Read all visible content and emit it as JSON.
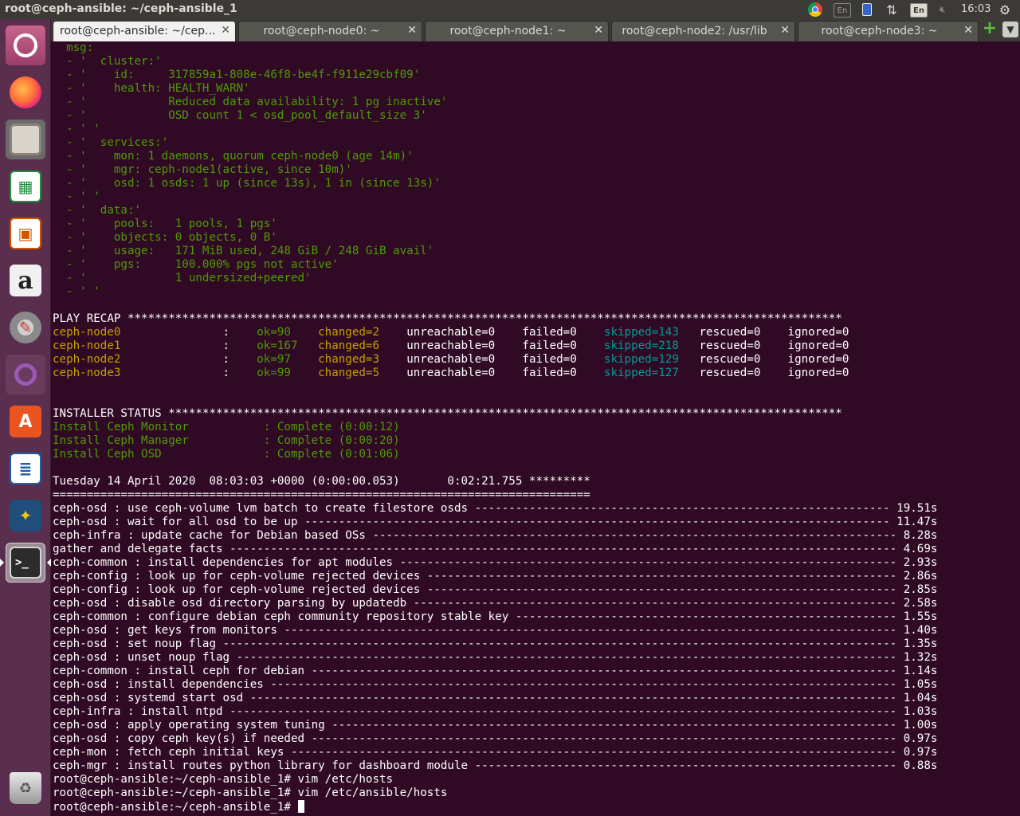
{
  "window": {
    "title": "root@ceph-ansible: ~/ceph-ansible_1"
  },
  "tray": {
    "keyboard_inactive": "En",
    "keyboard_active": "En",
    "clock": "16:03"
  },
  "launcher": {
    "items": [
      "ubuntu-dash",
      "firefox",
      "files",
      "libreoffice-calc",
      "libreoffice-impress",
      "amazon",
      "system-settings",
      "unity-tweak",
      "software-center",
      "libreoffice-writer",
      "mines",
      "terminal",
      "trash"
    ]
  },
  "tabs": [
    {
      "label": "root@ceph-ansible: ~/cep...",
      "active": true
    },
    {
      "label": "root@ceph-node0: ~"
    },
    {
      "label": "root@ceph-node1: ~"
    },
    {
      "label": "root@ceph-node2: /usr/lib"
    },
    {
      "label": "root@ceph-node3: ~"
    }
  ],
  "terminal": {
    "msg_lines": [
      "  msg:",
      "  - '  cluster:'",
      "  - '    id:     317859a1-808e-46f8-be4f-f911e29cbf09'",
      "  - '    health: HEALTH_WARN'",
      "  - '            Reduced data availability: 1 pg inactive'",
      "  - '            OSD count 1 < osd_pool_default_size 3'",
      "  - ' '",
      "  - '  services:'",
      "  - '    mon: 1 daemons, quorum ceph-node0 (age 14m)'",
      "  - '    mgr: ceph-node1(active, since 10m)'",
      "  - '    osd: 1 osds: 1 up (since 13s), 1 in (since 13s)'",
      "  - ' '",
      "  - '  data:'",
      "  - '    pools:   1 pools, 1 pgs'",
      "  - '    objects: 0 objects, 0 B'",
      "  - '    usage:   171 MiB used, 248 GiB / 248 GiB avail'",
      "  - '    pgs:     100.000% pgs not active'",
      "  - '             1 undersized+peered'",
      "  - ' '"
    ],
    "play_recap_header": "PLAY RECAP *********************************************************************************************************",
    "recap": [
      {
        "host": "ceph-node0               ",
        "sep": ": ",
        "ok": "ok=90 ",
        "changed": "changed=2 ",
        "unreachable": "unreachable=0 ",
        "failed": "failed=0 ",
        "skipped": "skipped=143",
        "rescued": "rescued=0 ",
        "ignored": "ignored=0"
      },
      {
        "host": "ceph-node1               ",
        "sep": ": ",
        "ok": "ok=167",
        "changed": "changed=6 ",
        "unreachable": "unreachable=0 ",
        "failed": "failed=0 ",
        "skipped": "skipped=218",
        "rescued": "rescued=0 ",
        "ignored": "ignored=0"
      },
      {
        "host": "ceph-node2               ",
        "sep": ": ",
        "ok": "ok=97 ",
        "changed": "changed=3 ",
        "unreachable": "unreachable=0 ",
        "failed": "failed=0 ",
        "skipped": "skipped=129",
        "rescued": "rescued=0 ",
        "ignored": "ignored=0"
      },
      {
        "host": "ceph-node3               ",
        "sep": ": ",
        "ok": "ok=99 ",
        "changed": "changed=5 ",
        "unreachable": "unreachable=0 ",
        "failed": "failed=0 ",
        "skipped": "skipped=127",
        "rescued": "rescued=0 ",
        "ignored": "ignored=0"
      }
    ],
    "installer_status_header": "INSTALLER STATUS ***************************************************************************************************",
    "installer_status": [
      "Install Ceph Monitor           : Complete (0:00:12)",
      "Install Ceph Manager           : Complete (0:00:20)",
      "Install Ceph OSD               : Complete (0:01:06)"
    ],
    "timing_line": "Tuesday 14 April 2020  08:03:03 +0000 (0:00:00.053)       0:02:21.755 *********",
    "separator_line": "===============================================================================",
    "profile_tasks": [
      "ceph-osd : use ceph-volume lvm batch to create filestore osds ------------------------------------------------------------- 19.51s",
      "ceph-osd : wait for all osd to be up -------------------------------------------------------------------------------------- 11.47s",
      "ceph-infra : update cache for Debian based OSs ----------------------------------------------------------------------------- 8.28s",
      "gather and delegate facts -------------------------------------------------------------------------------------------------- 4.69s",
      "ceph-common : install dependencies for apt modules ------------------------------------------------------------------------- 2.93s",
      "ceph-config : look up for ceph-volume rejected devices --------------------------------------------------------------------- 2.86s",
      "ceph-config : look up for ceph-volume rejected devices --------------------------------------------------------------------- 2.85s",
      "ceph-osd : disable osd directory parsing by updatedb ----------------------------------------------------------------------- 2.58s",
      "ceph-common : configure debian ceph community repository stable key -------------------------------------------------------- 1.55s",
      "ceph-osd : get keys from monitors ------------------------------------------------------------------------------------------ 1.40s",
      "ceph-osd : set noup flag --------------------------------------------------------------------------------------------------- 1.35s",
      "ceph-osd : unset noup flag ------------------------------------------------------------------------------------------------- 1.32s",
      "ceph-common : install ceph for debian -------------------------------------------------------------------------------------- 1.14s",
      "ceph-osd : install dependencies -------------------------------------------------------------------------------------------- 1.05s",
      "ceph-osd : systemd start osd ----------------------------------------------------------------------------------------------- 1.04s",
      "ceph-infra : install ntpd -------------------------------------------------------------------------------------------------- 1.03s",
      "ceph-osd : apply operating system tuning ----------------------------------------------------------------------------------- 1.00s",
      "ceph-osd : copy ceph key(s) if needed -------------------------------------------------------------------------------------- 0.97s",
      "ceph-mon : fetch ceph initial keys ----------------------------------------------------------------------------------------- 0.97s",
      "ceph-mgr : install routes python library for dashboard module -------------------------------------------------------------- 0.88s"
    ],
    "commands": [
      "root@ceph-ansible:~/ceph-ansible_1# vim /etc/hosts",
      "root@ceph-ansible:~/ceph-ansible_1# vim /etc/ansible/hosts"
    ],
    "prompt": "root@ceph-ansible:~/ceph-ansible_1# "
  },
  "colors": {
    "terminal_bg": "#300a24",
    "ok_green": "#4e9a06",
    "changed_yellow": "#c4a000",
    "skipped_cyan": "#06989a",
    "text_white": "#ffffff"
  }
}
